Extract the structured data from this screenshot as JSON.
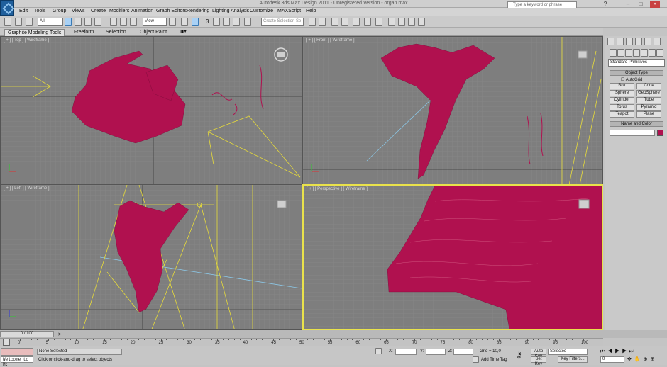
{
  "window": {
    "title": "Autodesk 3ds Max Design 2011 - Unregistered Version - organ.max"
  },
  "search": {
    "placeholder": "Type a keyword or phrase"
  },
  "menu": [
    "Edit",
    "Tools",
    "Group",
    "Views",
    "Create",
    "Modifiers",
    "Animation",
    "Graph Editors",
    "Rendering",
    "Lighting Analysis",
    "Customize",
    "MAXScript",
    "Help"
  ],
  "toolbar": {
    "filter_value": "All",
    "refcoord_value": "View",
    "selection_set_placeholder": "Create Selection Se",
    "snap_value": "3"
  },
  "ribbon": {
    "tabs": [
      "Graphite Modeling Tools",
      "Freeform",
      "Selection",
      "Object Paint"
    ]
  },
  "viewports": {
    "top": "[ + ] [ Top ] [ Wireframe ]",
    "front": "[ + ] [ Front ] [ Wireframe ]",
    "left": "[ + ] [ Left ] [ Wireframe ]",
    "perspective": "[ + ] [ Perspective ] [ Wireframe ]"
  },
  "colors": {
    "object": "#b0114f",
    "helper": "#e8dc3a",
    "active_border": "#e9e24b",
    "grid": "#8a8a8a"
  },
  "command_panel": {
    "category": "Standard Primitives",
    "object_type_header": "Object Type",
    "autogrid": "AutoGrid",
    "primitives": [
      "Box",
      "Cone",
      "Sphere",
      "GeoSphere",
      "Cylinder",
      "Tube",
      "Torus",
      "Pyramid",
      "Teapot",
      "Plane"
    ],
    "name_color_header": "Name and Color"
  },
  "timeline": {
    "slider": "0 / 100",
    "ticks": [
      "0",
      "5",
      "10",
      "15",
      "20",
      "25",
      "30",
      "35",
      "40",
      "45",
      "50",
      "55",
      "60",
      "65",
      "70",
      "75",
      "80",
      "85",
      "90",
      "95",
      "100"
    ]
  },
  "status": {
    "maxscript": "Welcome to M:",
    "selection": "None Selected",
    "prompt": "Click or click-and-drag to select objects",
    "x_label": "X:",
    "y_label": "Y:",
    "z_label": "Z:",
    "grid": "Grid = 10,0",
    "add_time_tag": "Add Time Tag",
    "auto_key": "Auto Key",
    "set_key": "Set Key",
    "key_mode": "Selected",
    "key_filters": "Key Filters...",
    "frame": "0"
  }
}
